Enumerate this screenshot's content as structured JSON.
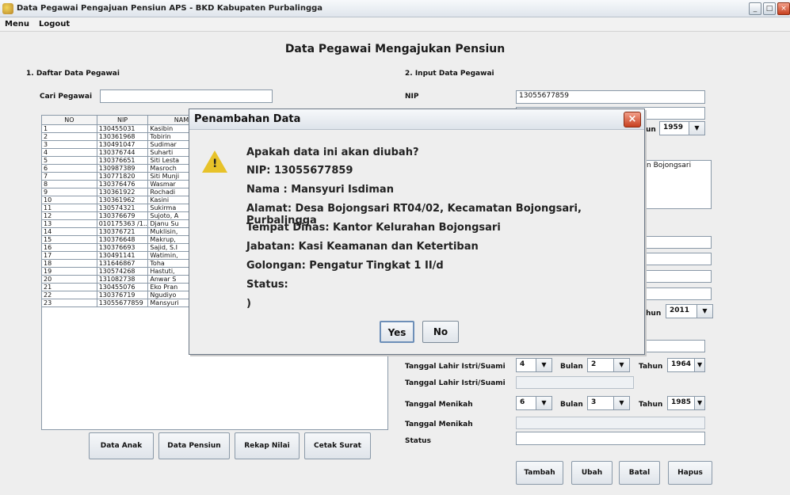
{
  "window": {
    "title": "Data Pegawai Pengajuan Pensiun APS - BKD Kabupaten Purbalingga"
  },
  "menu": [
    {
      "label": "Menu"
    },
    {
      "label": "Logout"
    }
  ],
  "page": {
    "title": "Data Pegawai Mengajukan Pensiun"
  },
  "list_section": {
    "heading": "1. Daftar Data Pegawai",
    "search_label": "Cari Pegawai",
    "search_value": "",
    "columns": [
      "NO",
      "NIP",
      "NAMA",
      ""
    ],
    "rows": [
      {
        "no": "1",
        "nip": "130455031",
        "nama": "Kasibin"
      },
      {
        "no": "2",
        "nip": "130361968",
        "nama": "Tobirin"
      },
      {
        "no": "3",
        "nip": "130491047",
        "nama": "Sudimar"
      },
      {
        "no": "4",
        "nip": "130376744",
        "nama": "Suharti"
      },
      {
        "no": "5",
        "nip": "130376651",
        "nama": "Siti Lesta"
      },
      {
        "no": "6",
        "nip": "130987389",
        "nama": "Masroch"
      },
      {
        "no": "7",
        "nip": "130771820",
        "nama": "Siti Munji"
      },
      {
        "no": "8",
        "nip": "130376476",
        "nama": "Wasmar"
      },
      {
        "no": "9",
        "nip": "130361922",
        "nama": "Rochadi"
      },
      {
        "no": "10",
        "nip": "130361962",
        "nama": "Kasini"
      },
      {
        "no": "11",
        "nip": "130574321",
        "nama": "Sukirma"
      },
      {
        "no": "12",
        "nip": "130376679",
        "nama": "Sujoto, A"
      },
      {
        "no": "13",
        "nip": "010175363 /1...",
        "nama": "Djanu Su"
      },
      {
        "no": "14",
        "nip": "130376721",
        "nama": "Muklisin,"
      },
      {
        "no": "15",
        "nip": "130376648",
        "nama": "Makrup,"
      },
      {
        "no": "16",
        "nip": "130376693",
        "nama": "Sajid, S.I"
      },
      {
        "no": "17",
        "nip": "130491141",
        "nama": "Watimin,"
      },
      {
        "no": "18",
        "nip": "131646867",
        "nama": "Toha"
      },
      {
        "no": "19",
        "nip": "130574268",
        "nama": "Hastuti,"
      },
      {
        "no": "20",
        "nip": "131082738",
        "nama": "Anwar S"
      },
      {
        "no": "21",
        "nip": "130455076",
        "nama": "Eko Pran"
      },
      {
        "no": "22",
        "nip": "130376719",
        "nama": "Ngudiyo"
      },
      {
        "no": "23",
        "nip": "13055677859",
        "nama": "Mansyuri"
      }
    ],
    "buttons": [
      "Data Anak",
      "Data Pensiun",
      "Rekap Nilai",
      "Cetak Surat"
    ]
  },
  "input_section": {
    "heading": "2. Input Data Pegawai",
    "nip_label": "NIP",
    "nip_value": "13055677859",
    "tahun_label_partial": "un",
    "tahun_value": "1959",
    "alamat_partial": "n Bojongsari",
    "tahun2_label_partial": "hun",
    "tahun2_value": "2011",
    "tgl_lahir_label": "Tanggal Lahir Istri/Suami",
    "tgl_lahir_day": "4",
    "tgl_lahir_bulan_label": "Bulan",
    "tgl_lahir_month": "2",
    "tgl_lahir_tahun_label": "Tahun",
    "tgl_lahir_year": "1964",
    "tgl_lahir2_label": "Tanggal Lahir Istri/Suami",
    "tgl_menikah_label": "Tanggal Menikah",
    "tgl_menikah_day": "6",
    "tgl_menikah_bulan_label": "Bulan",
    "tgl_menikah_month": "3",
    "tgl_menikah_tahun_label": "Tahun",
    "tgl_menikah_year": "1985",
    "tgl_menikah2_label": "Tanggal Menikah",
    "status_label": "Status",
    "status_value": "",
    "buttons": [
      "Tambah",
      "Ubah",
      "Batal",
      "Hapus"
    ]
  },
  "dialog": {
    "title": "Penambahan Data",
    "icon": "warning-icon",
    "lines": [
      "Apakah data ini akan diubah?",
      "NIP: 13055677859",
      "Nama : Mansyuri Isdiman",
      "Alamat: Desa Bojongsari RT04/02, Kecamatan Bojongsari, Purbalingga",
      "Tempat Dinas: Kantor Kelurahan Bojongsari",
      "Jabatan: Kasi Keamanan dan Ketertiban",
      "Golongan: Pengatur Tingkat 1 II/d",
      "Status:",
      ")"
    ],
    "yes": "Yes",
    "no": "No"
  },
  "colors": {
    "warning": "#e7c229",
    "close": "#c7401f"
  }
}
